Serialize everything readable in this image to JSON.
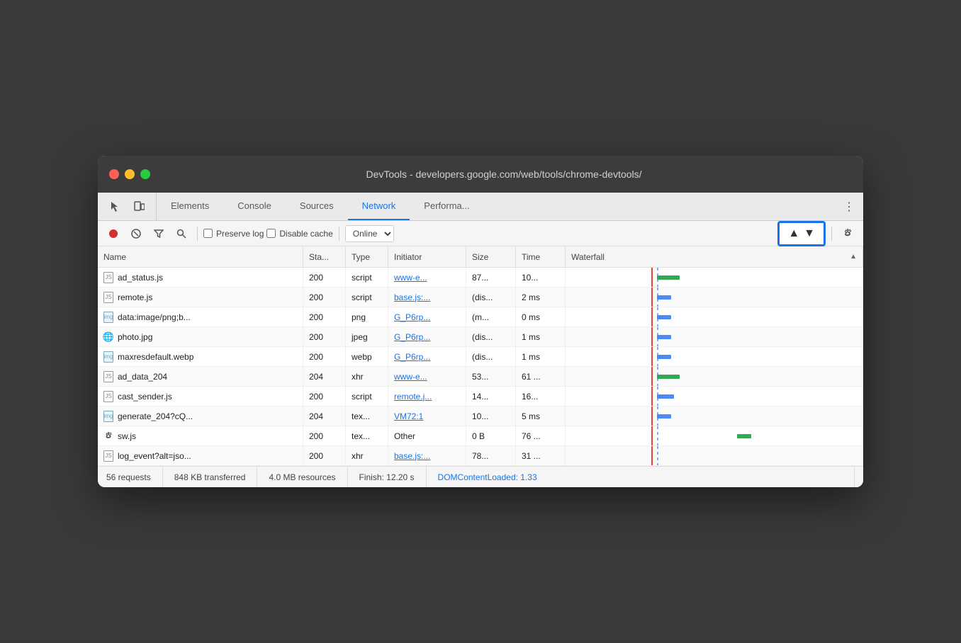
{
  "window": {
    "title": "DevTools - developers.google.com/web/tools/chrome-devtools/"
  },
  "tabs": {
    "icons": [
      "cursor",
      "device"
    ],
    "items": [
      {
        "id": "elements",
        "label": "Elements",
        "active": false
      },
      {
        "id": "console",
        "label": "Console",
        "active": false
      },
      {
        "id": "sources",
        "label": "Sources",
        "active": false
      },
      {
        "id": "network",
        "label": "Network",
        "active": true
      },
      {
        "id": "performance",
        "label": "Performa...",
        "active": false
      }
    ],
    "more": "⋮"
  },
  "toolbar": {
    "preserve_log_label": "Preserve log",
    "disable_cache_label": "Disable cache",
    "online_label": "Online",
    "upload_aria": "Upload",
    "download_aria": "Download"
  },
  "table": {
    "headers": [
      {
        "id": "name",
        "label": "Name"
      },
      {
        "id": "status",
        "label": "Sta..."
      },
      {
        "id": "type",
        "label": "Type"
      },
      {
        "id": "initiator",
        "label": "Initiator"
      },
      {
        "id": "size",
        "label": "Size"
      },
      {
        "id": "time",
        "label": "Time"
      },
      {
        "id": "waterfall",
        "label": "Waterfall"
      }
    ],
    "rows": [
      {
        "name": "ad_status.js",
        "fileType": "js",
        "status": "200",
        "type": "script",
        "initiator": "www-e...",
        "initiatorLink": true,
        "size": "87...",
        "time": "10...",
        "waterfall_type": "green_short"
      },
      {
        "name": "remote.js",
        "fileType": "js",
        "status": "200",
        "type": "script",
        "initiator": "base.js:...",
        "initiatorLink": true,
        "size": "(dis...",
        "time": "2 ms",
        "waterfall_type": "blue_dash"
      },
      {
        "name": "data:image/png;b...",
        "fileType": "img",
        "status": "200",
        "type": "png",
        "initiator": "G_P6rp...",
        "initiatorLink": true,
        "size": "(m...",
        "time": "0 ms",
        "waterfall_type": "blue_dash"
      },
      {
        "name": "photo.jpg",
        "fileType": "chrome",
        "status": "200",
        "type": "jpeg",
        "initiator": "G_P6rp...",
        "initiatorLink": true,
        "size": "(dis...",
        "time": "1 ms",
        "waterfall_type": "blue_dash"
      },
      {
        "name": "maxresdefault.webp",
        "fileType": "img",
        "status": "200",
        "type": "webp",
        "initiator": "G_P6rp...",
        "initiatorLink": true,
        "size": "(dis...",
        "time": "1 ms",
        "waterfall_type": "blue_dash"
      },
      {
        "name": "ad_data_204",
        "fileType": "js",
        "status": "204",
        "type": "xhr",
        "initiator": "www-e...",
        "initiatorLink": true,
        "size": "53...",
        "time": "61 ...",
        "waterfall_type": "green_short"
      },
      {
        "name": "cast_sender.js",
        "fileType": "js",
        "status": "200",
        "type": "script",
        "initiator": "remote.j...",
        "initiatorLink": true,
        "size": "14...",
        "time": "16...",
        "waterfall_type": "blue_solid"
      },
      {
        "name": "generate_204?cQ...",
        "fileType": "img",
        "status": "204",
        "type": "tex...",
        "initiator": "VM72:1",
        "initiatorLink": true,
        "size": "10...",
        "time": "5 ms",
        "waterfall_type": "blue_dash"
      },
      {
        "name": "sw.js",
        "fileType": "gear",
        "status": "200",
        "type": "tex...",
        "initiator": "Other",
        "initiatorLink": false,
        "size": "0 B",
        "time": "76 ...",
        "waterfall_type": "green_far"
      },
      {
        "name": "log_event?alt=jso...",
        "fileType": "js",
        "status": "200",
        "type": "xhr",
        "initiator": "base.js:...",
        "initiatorLink": true,
        "size": "78...",
        "time": "31 ...",
        "waterfall_type": "none"
      }
    ]
  },
  "statusbar": {
    "requests": "56 requests",
    "transferred": "848 KB transferred",
    "resources": "4.0 MB resources",
    "finish": "Finish: 12.20 s",
    "domcontent": "DOMContentLoaded: 1.33"
  }
}
